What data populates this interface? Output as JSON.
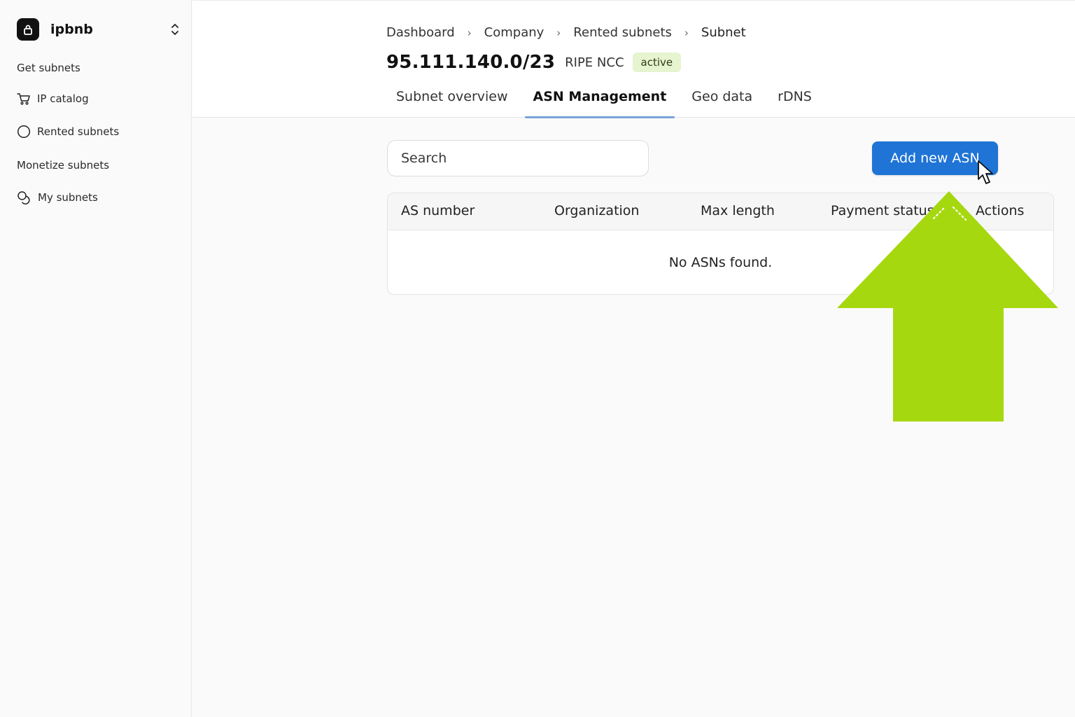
{
  "sidebar": {
    "org_name": "ipbnb",
    "sections": [
      {
        "label": "Get subnets"
      },
      {
        "label": "Monetize subnets"
      }
    ],
    "items": [
      {
        "label": "IP catalog",
        "icon": "cart-icon"
      },
      {
        "label": "Rented subnets",
        "icon": "circle-icon"
      },
      {
        "label": "My subnets",
        "icon": "coins-icon"
      }
    ]
  },
  "breadcrumb": [
    "Dashboard",
    "Company",
    "Rented subnets",
    "Subnet"
  ],
  "subnet": {
    "title": "95.111.140.0/23",
    "registry": "RIPE NCC",
    "status": "active"
  },
  "tabs": [
    {
      "label": "Subnet overview",
      "active": false
    },
    {
      "label": "ASN Management",
      "active": true
    },
    {
      "label": "Geo data",
      "active": false
    },
    {
      "label": "rDNS",
      "active": false
    }
  ],
  "toolbar": {
    "search_placeholder": "Search",
    "add_button": "Add new ASN"
  },
  "table": {
    "columns": [
      "AS number",
      "Organization",
      "Max length",
      "Payment status",
      "Actions"
    ],
    "empty_message": "No ASNs found."
  },
  "colors": {
    "accent": "#1f74d6",
    "active_badge_bg": "#e6f4cf",
    "highlight_arrow": "#a6d80f",
    "tab_underline": "#7aa3d8"
  }
}
